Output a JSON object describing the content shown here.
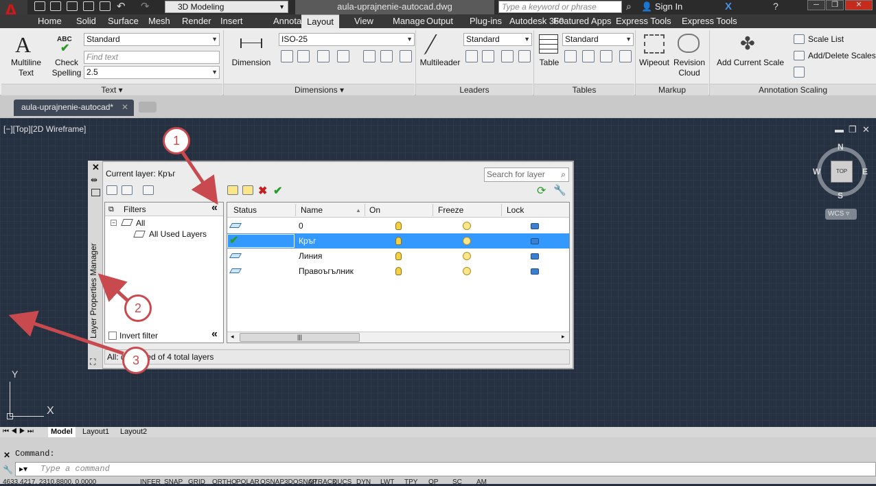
{
  "app": {
    "workspace": "3D Modeling",
    "doc_title": "aula-uprajnenie-autocad.dwg",
    "search_placeholder": "Type a keyword or phrase",
    "sign_in": "Sign In"
  },
  "menu_tabs": [
    "Home",
    "Solid",
    "Surface",
    "Mesh",
    "Render",
    "Insert",
    "Annotate",
    "Layout",
    "View",
    "Manage",
    "Output",
    "Plug-ins",
    "Autodesk 360",
    "Featured Apps",
    "Express Tools"
  ],
  "active_tab": "Annotate",
  "ribbon": {
    "text_panel": {
      "multiline_text": [
        "Multiline",
        "Text"
      ],
      "check_spelling": [
        "Check",
        "Spelling"
      ],
      "abc": "ABC",
      "style_value": "Standard",
      "find_placeholder": "Find text",
      "height_value": "2.5",
      "title": "Text"
    },
    "dimensions_panel": {
      "dimension": "Dimension",
      "style_value": "ISO-25",
      "title": "Dimensions"
    },
    "leaders_panel": {
      "multileader": "Multileader",
      "style_value": "Standard",
      "title": "Leaders"
    },
    "tables_panel": {
      "table": "Table",
      "style_value": "Standard",
      "title": "Tables"
    },
    "markup_panel": {
      "wipeout": "Wipeout",
      "revision_cloud": [
        "Revision",
        "Cloud"
      ],
      "title": "Markup"
    },
    "scaling_panel": {
      "add_current_scale": "Add Current Scale",
      "scale_list": "Scale List",
      "add_delete_scales": "Add/Delete Scales",
      "title": "Annotation Scaling"
    }
  },
  "doc_tab": "aula-uprajnenie-autocad*",
  "viewport_label": "[−][Top][2D Wireframe]",
  "viewcube": {
    "n": "N",
    "s": "S",
    "e": "E",
    "w": "W",
    "top": "TOP",
    "wcs": "WCS"
  },
  "layer_manager": {
    "vertical_title": "Layer Properties Manager",
    "current_layer": "Current layer: Кръг",
    "search_placeholder": "Search for layer",
    "filters_title": "Filters",
    "tree_all": "All",
    "tree_used": "All Used Layers",
    "invert_filter": "Invert filter",
    "columns": [
      "Status",
      "Name",
      "On",
      "Freeze",
      "Lock"
    ],
    "layers": [
      {
        "name": "0",
        "current": false
      },
      {
        "name": "Кръг",
        "current": true
      },
      {
        "name": "Линия",
        "current": false
      },
      {
        "name": "Правоъгълник",
        "current": false
      }
    ],
    "status_line": "All: 4 layers displayed of 4 total layers",
    "status_visible": "All:      displayed of 4 total layers"
  },
  "callouts": [
    "1",
    "2",
    "3"
  ],
  "layout_tabs": [
    "Model",
    "Layout1",
    "Layout2"
  ],
  "command": {
    "history": "Command:",
    "placeholder": "Type a command"
  },
  "status_buttons": [
    "INFER",
    "SNAP",
    "GRID",
    "ORTHO",
    "POLAR",
    "OSNAP",
    "3DOSNAP",
    "OTRACK",
    "DUCS",
    "DYN",
    "LWT",
    "TPY",
    "QP",
    "SC",
    "AM"
  ],
  "coords": "4633.4217, 2310.8800, 0.0000",
  "colors": {
    "accent": "#3399ff",
    "callout": "#c84a4e",
    "canvas": "#253040"
  }
}
